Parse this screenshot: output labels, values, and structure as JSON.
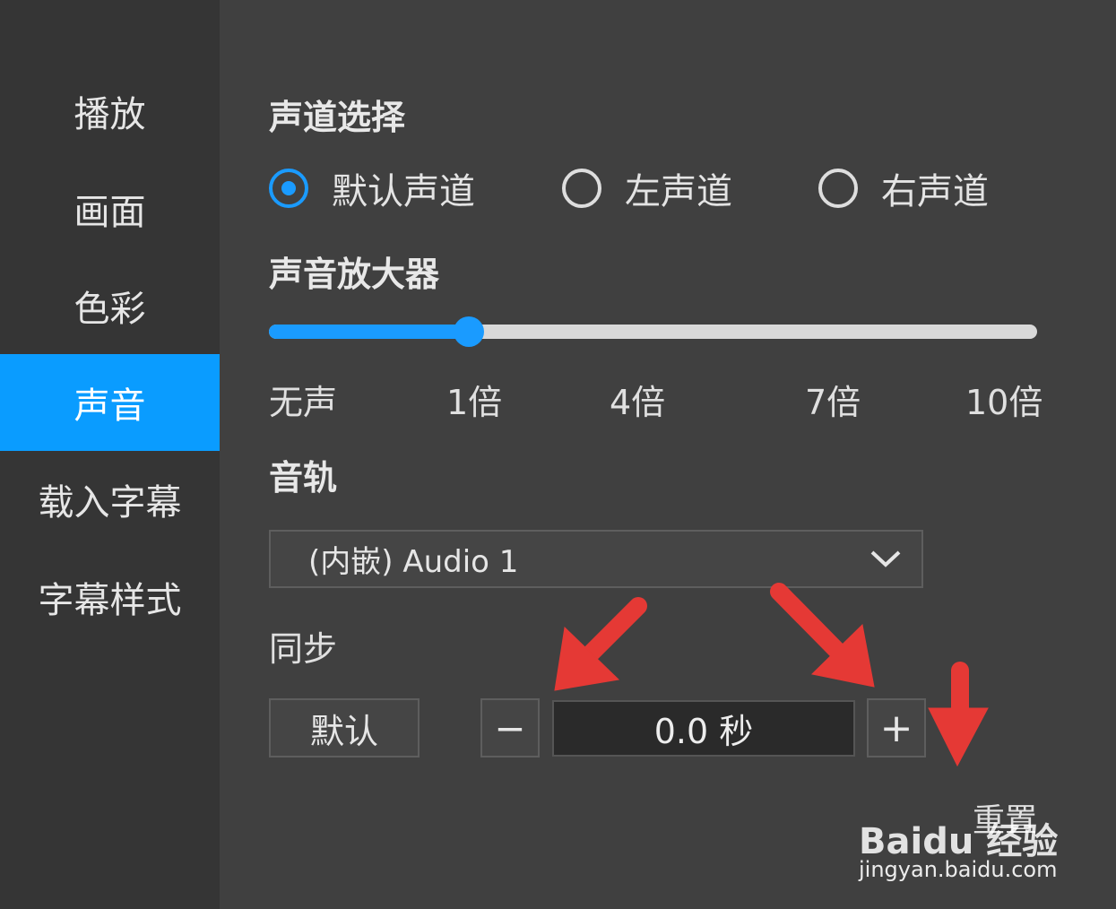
{
  "sidebar": {
    "items": [
      {
        "label": "播放"
      },
      {
        "label": "画面"
      },
      {
        "label": "色彩"
      },
      {
        "label": "声音",
        "active": true
      },
      {
        "label": "载入字幕"
      },
      {
        "label": "字幕样式"
      }
    ]
  },
  "channel": {
    "title": "声道选择",
    "options": [
      {
        "label": "默认声道",
        "checked": true
      },
      {
        "label": "左声道",
        "checked": false
      },
      {
        "label": "右声道",
        "checked": false
      }
    ]
  },
  "amplifier": {
    "title": "声音放大器",
    "value_fraction": 0.26,
    "ticks": [
      "无声",
      "1倍",
      "4倍",
      "7倍",
      "10倍"
    ]
  },
  "audio_track": {
    "title": "音轨",
    "selected": "(内嵌) Audio 1"
  },
  "sync": {
    "title": "同步",
    "default_label": "默认",
    "minus_label": "−",
    "value": "0.0 秒",
    "plus_label": "+",
    "reset_label": "重置"
  },
  "watermark": {
    "logo": "Baidu 经验",
    "url": "jingyan.baidu.com"
  },
  "colors": {
    "accent": "#1a9bff",
    "sidebar_active": "#0a9cff",
    "annotation_arrow": "#e53935"
  },
  "icons": {
    "dropdown": "chevron-down-icon",
    "annotation": "red-arrow-icon"
  }
}
